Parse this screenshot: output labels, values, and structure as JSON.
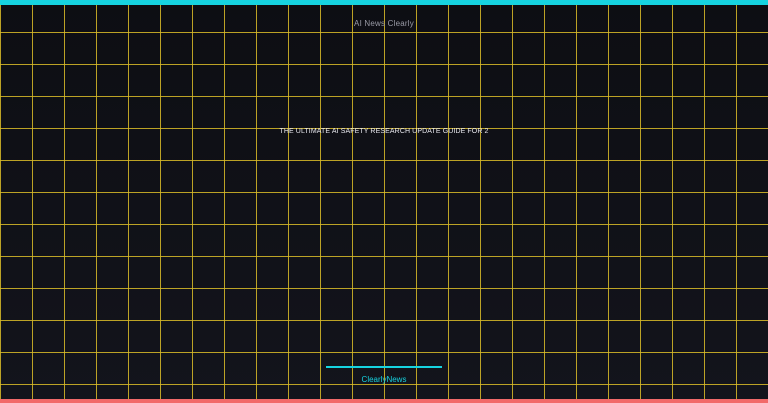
{
  "colors": {
    "top_bar": "#16d3e0",
    "bottom_bar": "#f26a6a",
    "grid_lines": "#dabc28",
    "background": "#0f1016",
    "accent": "#16d3e0"
  },
  "header": {
    "brand": "AI News Clearly"
  },
  "main": {
    "headline": "THE ULTIMATE AI SAFETY RESEARCH UPDATE GUIDE FOR 2"
  },
  "footer": {
    "brand": "ClearlyNews"
  }
}
